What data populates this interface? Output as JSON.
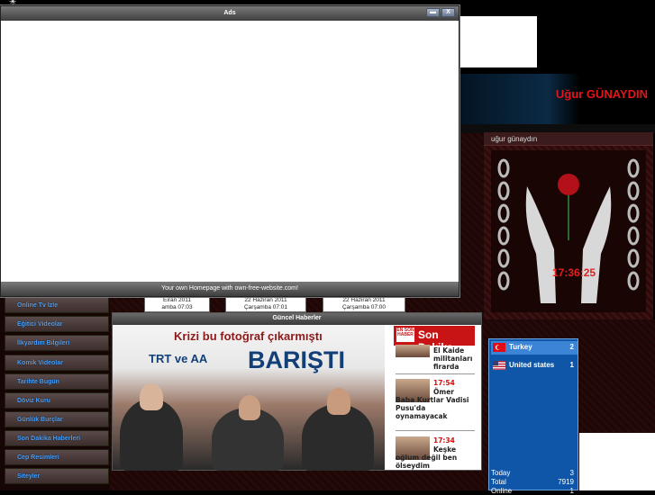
{
  "popup": {
    "title": "Ads",
    "footer": "Your own Homepage with own-free-website.com!",
    "minimize_label": "▬",
    "close_label": "X"
  },
  "banner": {
    "name": "Uğur GÜNAYDIN"
  },
  "sidebar_panel": {
    "title": "uğur günaydın",
    "clock": "17:36:25"
  },
  "menu": {
    "items": [
      {
        "label": "Online Tv İzle"
      },
      {
        "label": "Eğitici Videolar"
      },
      {
        "label": "İlkyardım Bilgileri"
      },
      {
        "label": "Komik Videolar"
      },
      {
        "label": "Tarihte Bugün"
      },
      {
        "label": "Döviz Kuru"
      },
      {
        "label": "Günlük Burçlar"
      },
      {
        "label": "Son Dakika Haberleri"
      },
      {
        "label": "Cep Resimleri"
      },
      {
        "label": "Siteyler"
      }
    ]
  },
  "dates": [
    {
      "line1": "Eiran 2011",
      "line2": "amba 07:03"
    },
    {
      "line1": "22 Haziran 2011",
      "line2": "Çarşamba 07:01"
    },
    {
      "line1": "22 Haziran 2011",
      "line2": "Çarşamba 07:00"
    }
  ],
  "news": {
    "title": "Güncel Haberler",
    "image_caption": "Krizi bu fotoğraf çıkarmıştı",
    "image_logos": "TRT ve AA",
    "image_headline": "BARIŞTI",
    "sondakika_badge": "EN SON HABER",
    "sondakika_label": "Son Dakika",
    "items": [
      {
        "time": "",
        "text": "El Kaide militanları firarda"
      },
      {
        "time": "17:54",
        "text": "Ömer Baba Kurtlar Vadisi Pusu'da oynamayacak"
      },
      {
        "time": "17:34",
        "text": "Keşke oğlum değil ben ölseydim"
      }
    ]
  },
  "stats": {
    "countries": [
      {
        "name": "Turkey",
        "count": "2"
      },
      {
        "name": "United states",
        "count": "1"
      }
    ],
    "today_label": "Today",
    "today_value": "3",
    "total_label": "Total",
    "total_value": "7919",
    "online_label": "Online",
    "online_value": "1"
  },
  "colors": {
    "banner_name": "#e3141a",
    "menu_text": "#4aa3ff",
    "stats_bg": "#0f56a8",
    "sondakika_bg": "#c81414"
  }
}
